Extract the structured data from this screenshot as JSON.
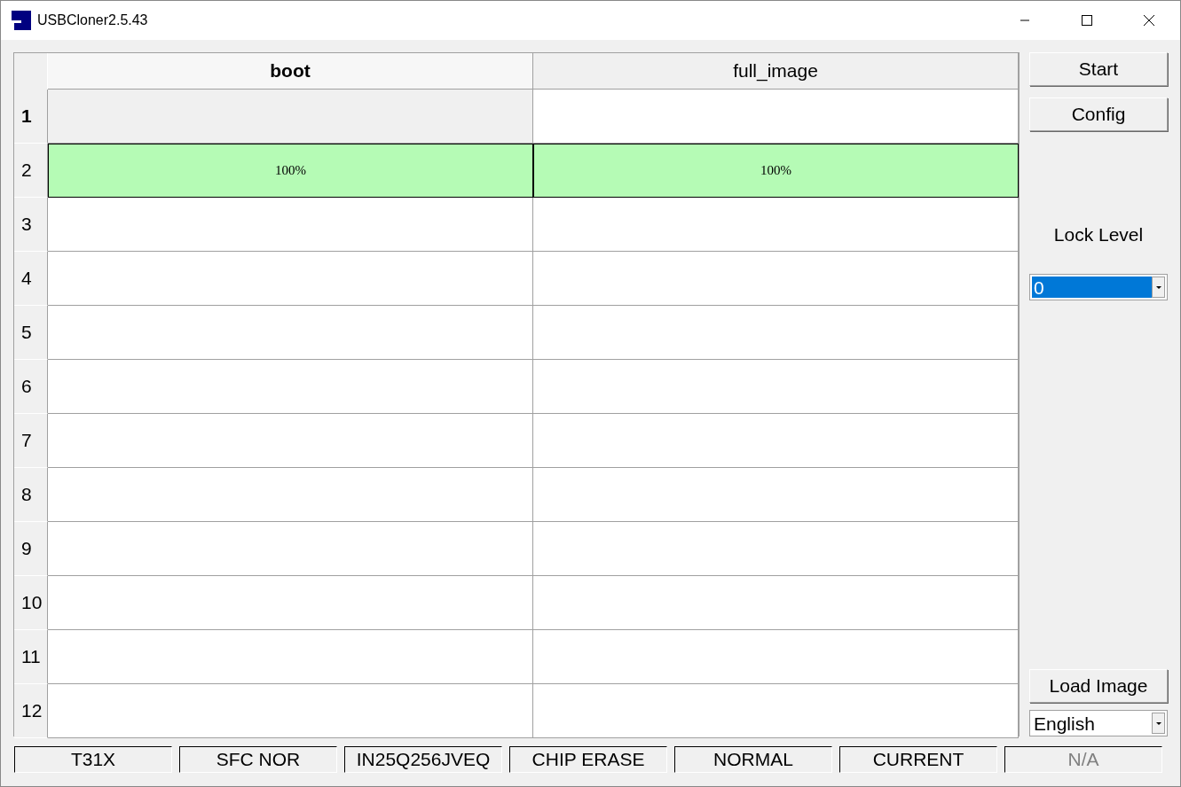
{
  "window": {
    "title": "USBCloner2.5.43"
  },
  "table": {
    "columns": [
      {
        "label": "boot",
        "selected": true
      },
      {
        "label": "full_image",
        "selected": false
      }
    ],
    "rows": [
      {
        "label": "1",
        "selected": true,
        "cells": [
          {
            "text": "",
            "complete": false
          },
          {
            "text": "",
            "complete": false
          }
        ]
      },
      {
        "label": "2",
        "selected": false,
        "cells": [
          {
            "text": "100%",
            "complete": true
          },
          {
            "text": "100%",
            "complete": true
          }
        ]
      },
      {
        "label": "3",
        "selected": false,
        "cells": [
          {
            "text": "",
            "complete": false
          },
          {
            "text": "",
            "complete": false
          }
        ]
      },
      {
        "label": "4",
        "selected": false,
        "cells": [
          {
            "text": "",
            "complete": false
          },
          {
            "text": "",
            "complete": false
          }
        ]
      },
      {
        "label": "5",
        "selected": false,
        "cells": [
          {
            "text": "",
            "complete": false
          },
          {
            "text": "",
            "complete": false
          }
        ]
      },
      {
        "label": "6",
        "selected": false,
        "cells": [
          {
            "text": "",
            "complete": false
          },
          {
            "text": "",
            "complete": false
          }
        ]
      },
      {
        "label": "7",
        "selected": false,
        "cells": [
          {
            "text": "",
            "complete": false
          },
          {
            "text": "",
            "complete": false
          }
        ]
      },
      {
        "label": "8",
        "selected": false,
        "cells": [
          {
            "text": "",
            "complete": false
          },
          {
            "text": "",
            "complete": false
          }
        ]
      },
      {
        "label": "9",
        "selected": false,
        "cells": [
          {
            "text": "",
            "complete": false
          },
          {
            "text": "",
            "complete": false
          }
        ]
      },
      {
        "label": "10",
        "selected": false,
        "cells": [
          {
            "text": "",
            "complete": false
          },
          {
            "text": "",
            "complete": false
          }
        ]
      },
      {
        "label": "11",
        "selected": false,
        "cells": [
          {
            "text": "",
            "complete": false
          },
          {
            "text": "",
            "complete": false
          }
        ]
      },
      {
        "label": "12",
        "selected": false,
        "cells": [
          {
            "text": "",
            "complete": false
          },
          {
            "text": "",
            "complete": false
          }
        ]
      }
    ]
  },
  "side_panel": {
    "buttons": [
      "Start",
      "Config"
    ],
    "lock_level_label": "Lock Level",
    "lock_level": {
      "value": "0",
      "focused": true
    },
    "load_button": "Load Image",
    "language": {
      "value": "English",
      "focused": false
    }
  },
  "status_bar": [
    {
      "text": "T31X",
      "disabled": false
    },
    {
      "text": "SFC NOR",
      "disabled": false
    },
    {
      "text": "IN25Q256JVEQ",
      "disabled": false
    },
    {
      "text": "CHIP ERASE",
      "disabled": false
    },
    {
      "text": "NORMAL",
      "disabled": false
    },
    {
      "text": "CURRENT",
      "disabled": false
    },
    {
      "text": "N/A",
      "disabled": true
    }
  ]
}
